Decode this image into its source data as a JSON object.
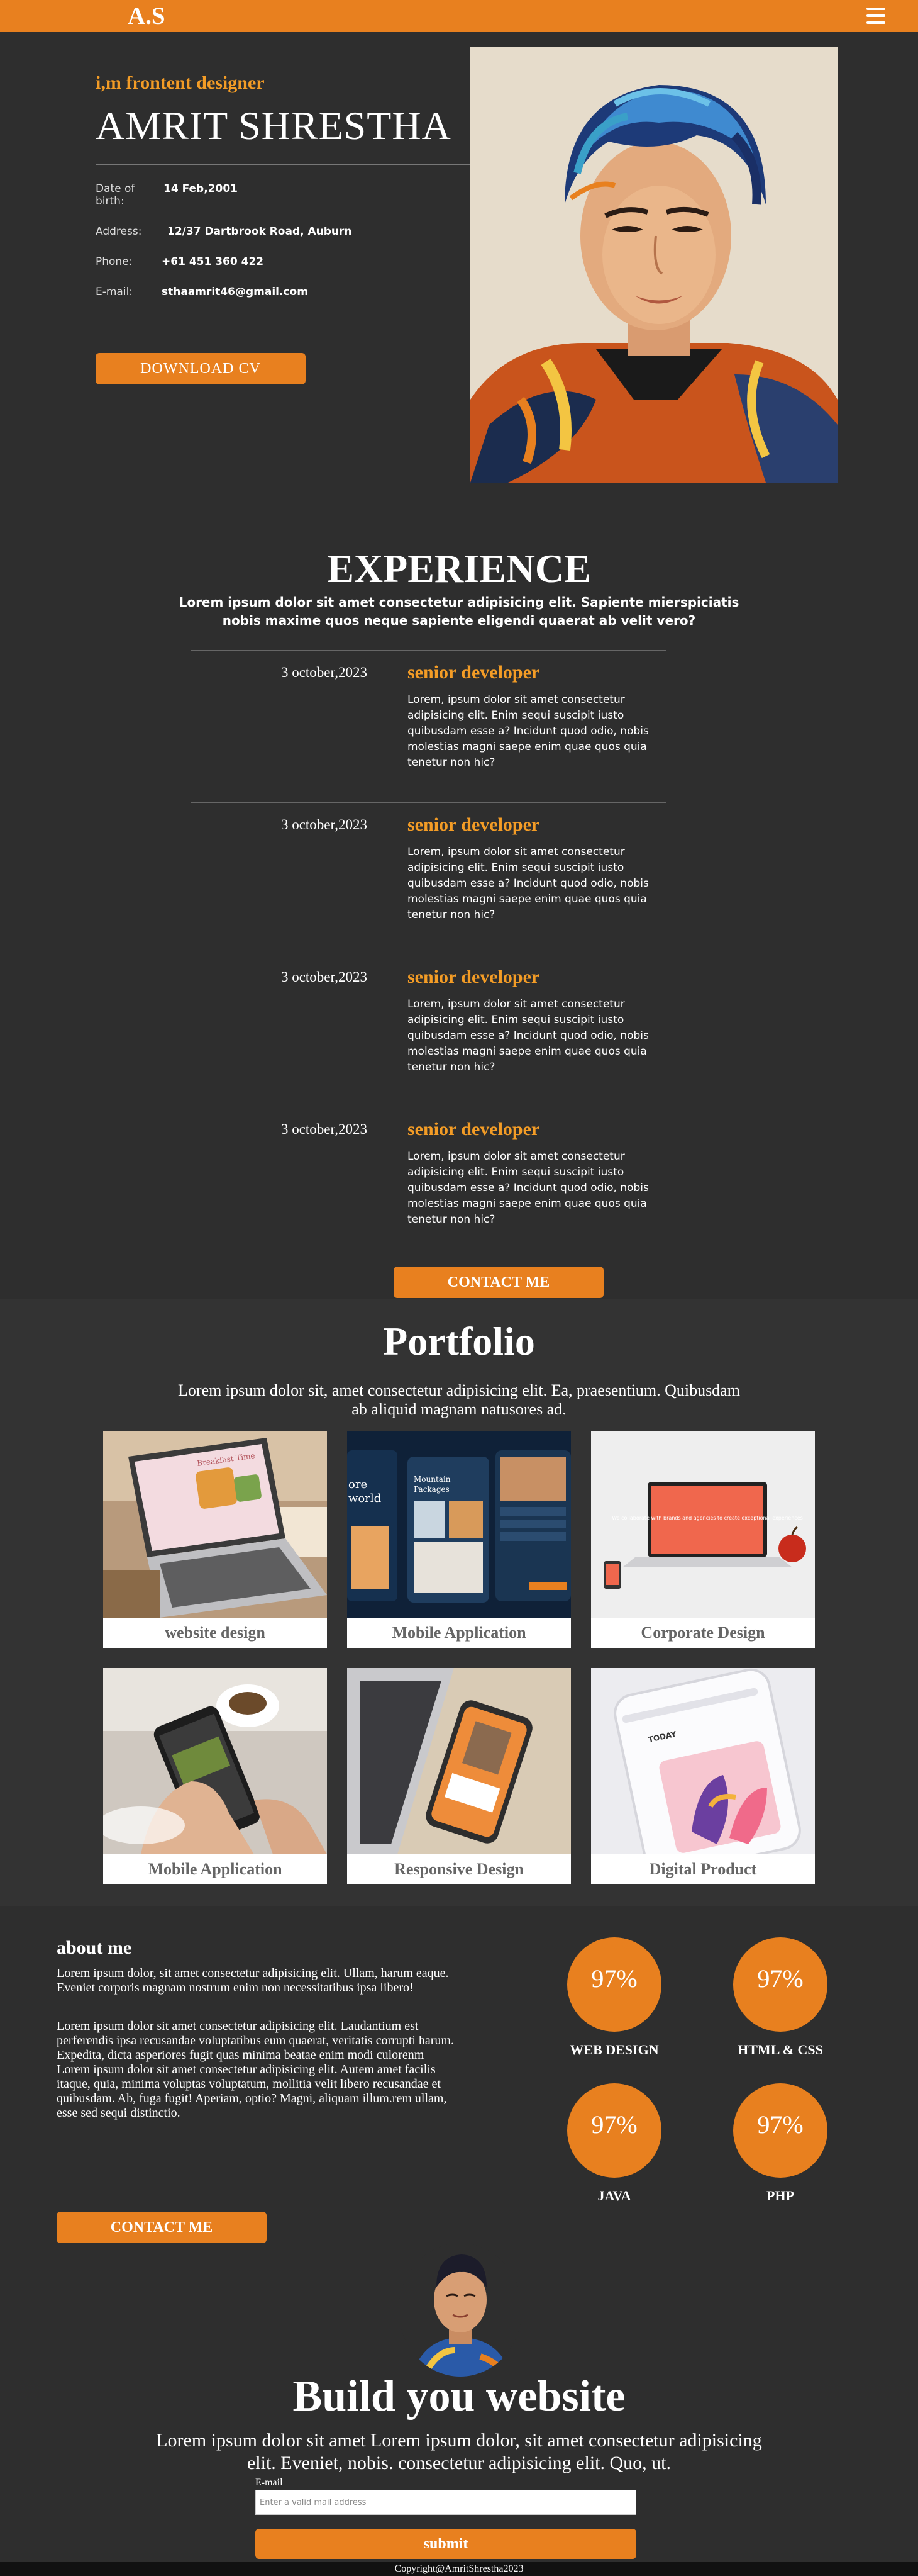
{
  "nav": {
    "logo": "A.S",
    "menu_icon": "hamburger-menu-icon"
  },
  "hero": {
    "tagline": "i,m frontent designer",
    "name": "AMRIT SHRESTHA",
    "info": [
      {
        "label": "Date of birth:",
        "value": "14 Feb,2001"
      },
      {
        "label": "Address:",
        "value": "12/37 Dartbrook Road, Auburn"
      },
      {
        "label": "Phone:",
        "value": "+61 451 360 422"
      },
      {
        "label": "E-mail:",
        "value": "sthaamrit46@gmail.com"
      }
    ],
    "download_label": "DOWNLOAD CV"
  },
  "experience": {
    "title": "EXPERIENCE",
    "subtitle": "Lorem ipsum dolor sit amet consectetur adipisicing elit. Sapiente mierspiciatis nobis maxime quos neque sapiente eligendi quaerat ab velit vero?",
    "items": [
      {
        "date": "3 october,2023",
        "role": "senior developer",
        "desc": "Lorem, ipsum dolor sit amet consectetur adipisicing elit. Enim sequi suscipit iusto quibusdam esse a? Incidunt quod odio, nobis molestias magni saepe enim quae quos quia tenetur non hic?"
      },
      {
        "date": "3 october,2023",
        "role": "senior developer",
        "desc": "Lorem, ipsum dolor sit amet consectetur adipisicing elit. Enim sequi suscipit iusto quibusdam esse a? Incidunt quod odio, nobis molestias magni saepe enim quae quos quia tenetur non hic?"
      },
      {
        "date": "3 october,2023",
        "role": "senior developer",
        "desc": "Lorem, ipsum dolor sit amet consectetur adipisicing elit. Enim sequi suscipit iusto quibusdam esse a? Incidunt quod odio, nobis molestias magni saepe enim quae quos quia tenetur non hic?"
      },
      {
        "date": "3 october,2023",
        "role": "senior developer",
        "desc": "Lorem, ipsum dolor sit amet consectetur adipisicing elit. Enim sequi suscipit iusto quibusdam esse a? Incidunt quod odio, nobis molestias magni saepe enim quae quos quia tenetur non hic?"
      }
    ],
    "contact_label": "CONTACT ME"
  },
  "portfolio": {
    "title": "Portfolio",
    "subtitle": "Lorem ipsum dolor sit, amet consectetur adipisicing elit. Ea, praesentium. Quibusdam ab aliquid magnam natusores ad.",
    "cards": [
      {
        "label": "website design"
      },
      {
        "label": "Mobile Application"
      },
      {
        "label": "Corporate Design"
      },
      {
        "label": "Mobile Application"
      },
      {
        "label": "Responsive Design"
      },
      {
        "label": "Digital Product"
      }
    ],
    "mock_texts": {
      "recipe": "Breakfast Time",
      "travel_1": "ore",
      "travel_2": "world",
      "travel_3": "Mountain",
      "travel_4": "Packages",
      "corporate": "We collaborate with brands and agencies to create exceptional experiences",
      "digital": "TODAY"
    }
  },
  "about": {
    "title": "about me",
    "p1": "Lorem ipsum dolor, sit amet consectetur adipisicing elit. Ullam, harum eaque. Eveniet corporis magnam nostrum enim non necessitatibus ipsa libero!",
    "p2": "Lorem ipsum dolor sit amet consectetur adipisicing elit. Laudantium est perferendis ipsa recusandae voluptatibus eum quaerat, veritatis corrupti harum. Expedita, dicta asperiores fugit quas minima beatae enim modi culorenm Lorem ipsum dolor sit amet consectetur adipisicing elit. Autem amet facilis itaque, quia, minima voluptas voluptatum, mollitia velit libero recusandae et quibusdam. Ab, fuga fugit! Aperiam, optio? Magni, aliquam illum.rem ullam, esse sed sequi distinctio.",
    "skills": [
      {
        "percent": "97%",
        "label": "WEB DESIGN",
        "level": 0.97
      },
      {
        "percent": "97%",
        "label": "HTML & CSS",
        "level": 0.97
      },
      {
        "percent": "97%",
        "label": "JAVA",
        "level": 0.97
      },
      {
        "percent": "97%",
        "label": "PHP",
        "level": 0.97
      }
    ],
    "contact_label": "CONTACT ME"
  },
  "build": {
    "title": "Build you website",
    "subtitle": "Lorem ipsum dolor sit amet Lorem ipsum dolor, sit amet consectetur adipisicing elit. Eveniet, nobis. consectetur adipisicing elit. Quo, ut.",
    "email_label": "E-mail",
    "email_placeholder": "Enter a valid mail address",
    "submit_label": "submit"
  },
  "footer": {
    "copyright": "Copyright@AmritShrestha2023"
  },
  "colors": {
    "accent": "#e8801f",
    "accent_text": "#f39c26",
    "background": "#2e2e2e",
    "panel": "#333333"
  }
}
